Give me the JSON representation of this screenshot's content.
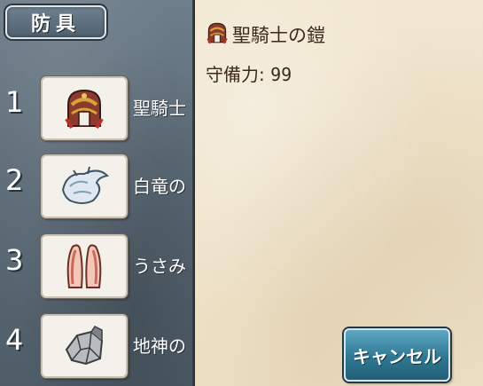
{
  "category": {
    "label": "防具"
  },
  "items": [
    {
      "number": "1",
      "name": "聖騎士",
      "icon": "holy-knight-armor-icon"
    },
    {
      "number": "2",
      "name": "白竜の",
      "icon": "white-dragon-armor-icon"
    },
    {
      "number": "3",
      "name": "うさみ",
      "icon": "rabbit-ears-icon"
    },
    {
      "number": "4",
      "name": "地神の",
      "icon": "earth-god-armor-icon"
    }
  ],
  "detail": {
    "name": "聖騎士の鎧",
    "icon": "holy-knight-armor-icon",
    "defense_label": "守備力:",
    "defense_value": "99"
  },
  "cancel_label": "キャンセル",
  "colors": {
    "left_panel": "#5d6c78",
    "right_panel": "#efe3c9",
    "cancel_button": "#2f7893",
    "detail_text": "#3b2a1c"
  }
}
